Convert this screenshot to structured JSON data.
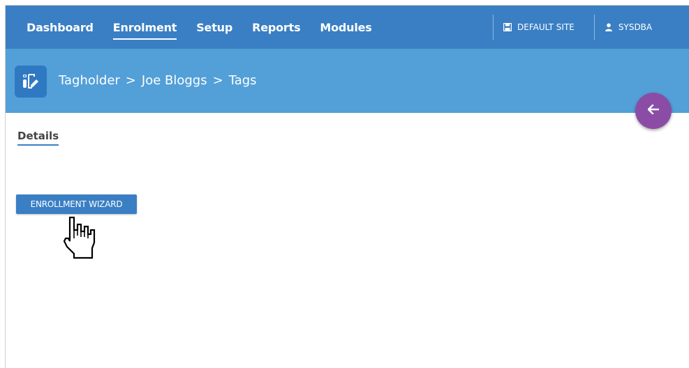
{
  "nav": {
    "items": [
      "Dashboard",
      "Enrolment",
      "Setup",
      "Reports",
      "Modules"
    ],
    "active": "Enrolment"
  },
  "header_right": {
    "site_label": "DEFAULT SITE",
    "site_icon": "save-icon",
    "user_label": "SYSDBA",
    "user_icon": "user-icon"
  },
  "breadcrumb": {
    "icon": "tag-edit-icon",
    "parts": [
      "Tagholder",
      ">",
      "Joe Bloggs",
      ">",
      "Tags"
    ]
  },
  "back_button": {
    "icon": "arrow-left-icon",
    "color": "#8b4ca6"
  },
  "tabs": {
    "details_label": "Details"
  },
  "actions": {
    "wizard_label": "ENROLLMENT WIZARD"
  },
  "colors": {
    "topbar": "#3a7fc4",
    "breadcrumb_bar": "#539fd8",
    "accent": "#3a7fc4"
  },
  "cursor": {
    "icon": "hand-pointer-icon"
  }
}
